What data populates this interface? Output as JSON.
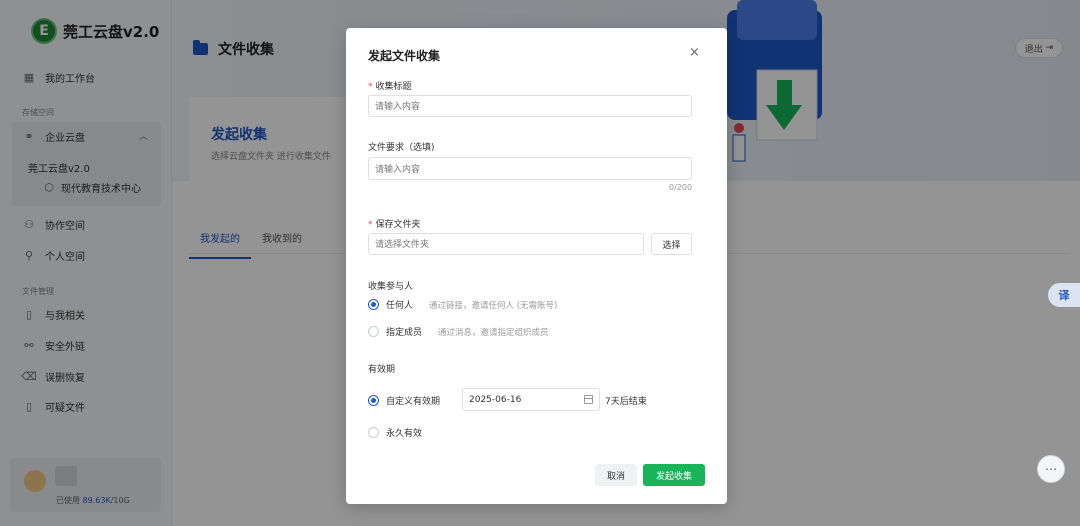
{
  "app": {
    "name": "莞工云盘v2.0",
    "logo_glyph": "E"
  },
  "sidebar": {
    "workbench": "我的工作台",
    "storage_label": "存储空间",
    "enterprise": "企业云盘",
    "enterprise_sub": "莞工云盘v2.0",
    "enterprise_child": "现代教育技术中心",
    "collab": "协作空间",
    "personal": "个人空间",
    "file_mgmt_label": "文件管理",
    "related": "与我相关",
    "secure_link": "安全外链",
    "recover": "误删恢复",
    "suspicious": "可疑文件",
    "usage": {
      "prefix": "已使用 ",
      "used": "89.63K",
      "total": "/10G"
    }
  },
  "main": {
    "title": "文件收集",
    "logout": "退出",
    "card": {
      "title": "发起收集",
      "desc": "选择云盘文件夹 进行收集文件"
    },
    "tabs": [
      "我发起的",
      "我收到的"
    ]
  },
  "fabs": {
    "translate": "译"
  },
  "modal": {
    "title": "发起文件收集",
    "close": "×",
    "collect_title_label": "收集标题",
    "collect_title_placeholder": "请输入内容",
    "requirement_label": "文件要求（选填)",
    "requirement_placeholder": "请输入内容",
    "counter": "0/200",
    "folder_label": "保存文件夹",
    "folder_placeholder": "请选择文件夹",
    "select_button": "选择",
    "participants_label": "收集参与人",
    "participants": [
      {
        "label": "任何人",
        "hint": "通过链接，邀请任何人 (无需账号)",
        "selected": true
      },
      {
        "label": "指定成员",
        "hint": "通过消息，邀请指定组织成员",
        "selected": false
      }
    ],
    "validity_label": "有效期",
    "validity_options": [
      {
        "label": "自定义有效期",
        "selected": true
      },
      {
        "label": "永久有效",
        "selected": false
      }
    ],
    "date_value": "2025-06-16",
    "date_suffix": "7天后结束",
    "cancel": "取消",
    "submit": "发起收集"
  },
  "colors": {
    "primary": "#1f58c7",
    "submit": "#19b45a",
    "required": "#e34d4d"
  }
}
